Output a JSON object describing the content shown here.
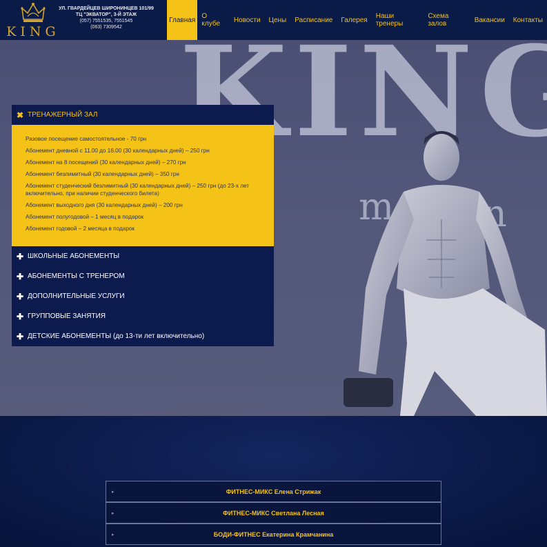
{
  "header": {
    "brand": "KING",
    "address_line1": "УЛ. ГВАРДЕЙЦЕВ ШИРОНИНЦЕВ 101/99",
    "address_line2": "ТЦ \"ЭКВАТОР\", 3-Й ЭТАЖ",
    "address_line3": "(057) 7551535, 7551545",
    "address_line4": "(063) 7309542"
  },
  "nav": {
    "items": [
      {
        "label": "Главная",
        "active": true
      },
      {
        "label": "О клубе"
      },
      {
        "label": "Новости"
      },
      {
        "label": "Цены"
      },
      {
        "label": "Расписание"
      },
      {
        "label": "Галерея"
      },
      {
        "label": "Наши тренеры"
      },
      {
        "label": "Схема залов"
      },
      {
        "label": "Вакансии"
      },
      {
        "label": "Контакты"
      }
    ]
  },
  "hero": {
    "bg_text": "KING",
    "bg_sub1": "m &",
    "bg_sub2": "n"
  },
  "accordion": {
    "open_section": {
      "icon": "close-icon",
      "title": "ТРЕНАЖЕРНЫЙ ЗАЛ",
      "prices": [
        "Разовое посещение самостоятельное - 70 грн",
        "Абонемент дневной с 11.00 до 16.00 (30 календарных дней) – 250 грн",
        "Абонемент на 8 посещений (30 календарных дней) – 270 грн",
        "Абонемент безлимитный (30 календарных дней) – 350 грн",
        "Абонемент студенческий безлимитный (30 календарных дней) – 250 грн (до 23-х лет включительно, при наличии студенческого билета)",
        "Абонемент выходного дня (30 календарных дней) – 200 грн",
        "Абонемент полугодовой – 1 месяц в подарок",
        "Абонемент годовой – 2 месяца в подарок"
      ]
    },
    "sections": [
      "ШКОЛЬНЫЕ АБОНЕМЕНТЫ",
      "АБОНЕМЕНТЫ С ТРЕНЕРОМ",
      "ДОПОЛНИТЕЛЬНЫЕ УСЛУГИ",
      "ГРУППОВЫЕ ЗАНЯТИЯ",
      "ДЕТСКИЕ АБОНЕМЕНТЫ (до 13-ти лет включительно)"
    ]
  },
  "trainers": [
    "ФИТНЕС-МИКС Елена Стрижак",
    "ФИТНЕС-МИКС Светлана Лесная",
    "БОДИ-ФИТНЕС Екатерина Крамчанина"
  ],
  "colors": {
    "accent": "#f5c218",
    "navy": "#0b1b47"
  }
}
